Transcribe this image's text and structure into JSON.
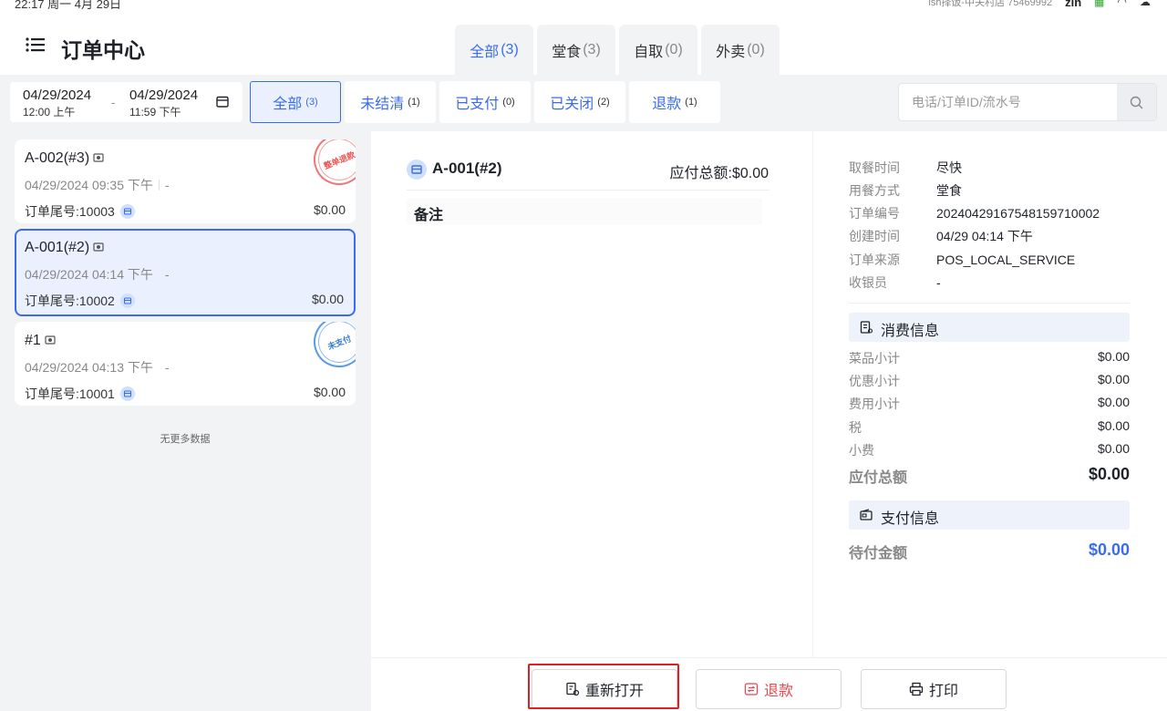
{
  "status_bar": {
    "time": "22:17 周一 4月 29日",
    "store": "lsh择饭-中关村店 75469992",
    "user": "zin"
  },
  "header": {
    "title": "订单中心",
    "type_tabs": [
      {
        "label": "全部",
        "count": "(3)"
      },
      {
        "label": "堂食",
        "count": "(3)"
      },
      {
        "label": "自取",
        "count": "(0)"
      },
      {
        "label": "外卖",
        "count": "(0)"
      }
    ]
  },
  "filter": {
    "start_date": "04/29/2024",
    "start_time": "12:00 上午",
    "end_date": "04/29/2024",
    "end_time": "11:59 下午",
    "dash": "-",
    "status_tabs": [
      {
        "label": "全部",
        "count": "(3)"
      },
      {
        "label": "未结清",
        "count": "(1)"
      },
      {
        "label": "已支付",
        "count": "(0)"
      },
      {
        "label": "已关闭",
        "count": "(2)"
      },
      {
        "label": "退款",
        "count": "(1)"
      }
    ],
    "search_placeholder": "电话/订单ID/流水号"
  },
  "orders": [
    {
      "no": "A-002(#3)",
      "time": "04/29/2024 09:35 下午",
      "table": "-",
      "tail": "订单尾号:10003",
      "amount": "$0.00",
      "stamp": "整单退款"
    },
    {
      "no": "A-001(#2)",
      "time": "04/29/2024 04:14 下午",
      "table": "-",
      "tail": "订单尾号:10002",
      "amount": "$0.00",
      "stamp": ""
    },
    {
      "no": "#1",
      "time": "04/29/2024 04:13 下午",
      "table": "-",
      "tail": "订单尾号:10001",
      "amount": "$0.00",
      "stamp": "未支付"
    }
  ],
  "no_more": "无更多数据",
  "detail": {
    "title": "A-001(#2)",
    "total_label": "应付总额:$0.00",
    "remark_label": "备注",
    "info": [
      {
        "k": "取餐时间",
        "v": "尽快"
      },
      {
        "k": "用餐方式",
        "v": "堂食"
      },
      {
        "k": "订单编号",
        "v": "20240429167548159710002"
      },
      {
        "k": "创建时间",
        "v": "04/29 04:14 下午"
      },
      {
        "k": "订单来源",
        "v": "POS_LOCAL_SERVICE"
      },
      {
        "k": "收银员",
        "v": "-"
      }
    ],
    "consume_title": "消费信息",
    "fees": [
      {
        "k": "菜品小计",
        "v": "$0.00"
      },
      {
        "k": "优惠小计",
        "v": "$0.00"
      },
      {
        "k": "费用小计",
        "v": "$0.00"
      },
      {
        "k": "税",
        "v": "$0.00"
      },
      {
        "k": "小费",
        "v": "$0.00"
      }
    ],
    "payable": {
      "k": "应付总额",
      "v": "$0.00"
    },
    "pay_title": "支付信息",
    "pending": {
      "k": "待付金额",
      "v": "$0.00"
    }
  },
  "actions": {
    "reopen": "重新打开",
    "refund": "退款",
    "print": "打印"
  },
  "colors": {
    "accent": "#3b6cf0",
    "danger": "#e5484d",
    "highlight": "#e02020"
  }
}
